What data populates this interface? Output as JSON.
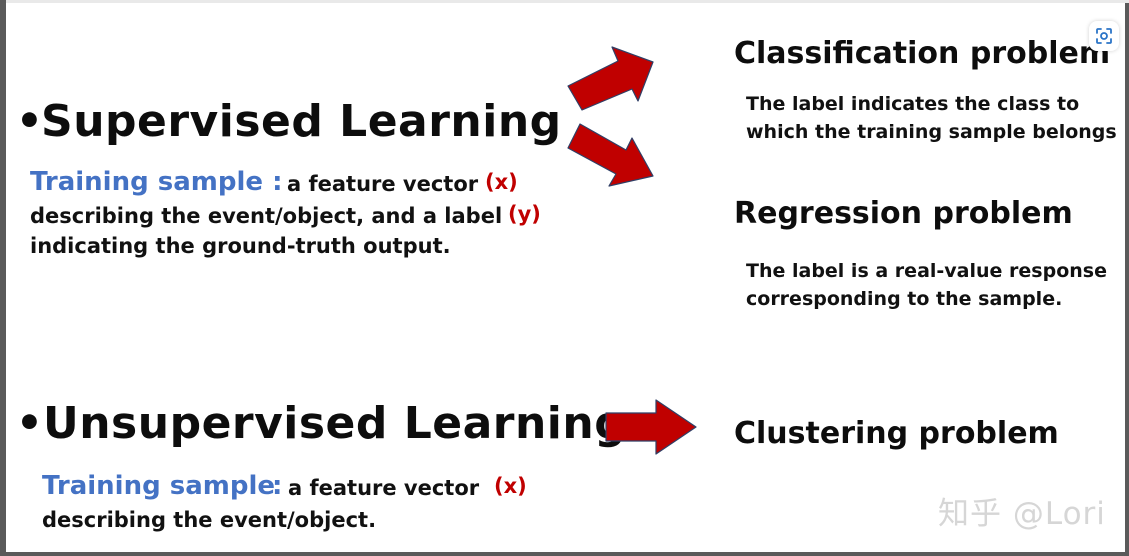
{
  "supervised": {
    "bullet": "•",
    "heading": "Supervised Learning",
    "training_label": "Training sample :",
    "line1_text": "a feature vector",
    "line1_var": "(x)",
    "line2_text": "describing the event/object, and a label",
    "line2_var": "(y)",
    "line3_text": "indicating the ground-truth output."
  },
  "classification": {
    "title": "Classification problem",
    "desc_line1": "The label indicates the class to",
    "desc_line2": "which the training sample belongs"
  },
  "regression": {
    "title": "Regression problem",
    "desc_line1": "The label is a real-value response",
    "desc_line2": "corresponding to the sample."
  },
  "unsupervised": {
    "bullet": "•",
    "heading": "Unsupervised Learning",
    "training_label": "Training sample",
    "training_colon": ":",
    "line1_text": "a feature vector",
    "line1_var": "(x)",
    "line2_text": "describing the event/object."
  },
  "clustering": {
    "title": "Clustering problem"
  },
  "watermark": {
    "text": "知乎 @Lori"
  },
  "colors": {
    "accent_blue": "#4472c4",
    "variable_red": "#c00000",
    "arrow_fill": "#c00000",
    "arrow_stroke": "#2f3f66",
    "watermark": "#d6d6d6"
  },
  "icons": {
    "scan_button": "scan-icon",
    "arrows": [
      "arrow-up-right-icon",
      "arrow-down-right-icon",
      "arrow-right-icon"
    ]
  }
}
